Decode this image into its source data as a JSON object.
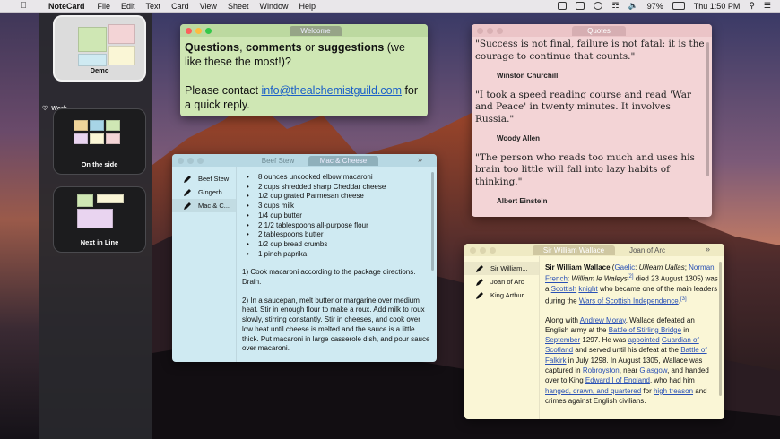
{
  "menubar": {
    "app": "NoteCard",
    "items": [
      "File",
      "Edit",
      "Text",
      "Card",
      "View",
      "Sheet",
      "Window",
      "Help"
    ],
    "battery": "97%",
    "clock": "Thu 1:50 PM"
  },
  "sidebar": {
    "boards": [
      {
        "label": "Demo"
      },
      {
        "label": "On the side"
      },
      {
        "label": "Next in Line"
      }
    ],
    "section": "Work"
  },
  "welcome": {
    "tab": "Welcome",
    "q_bold1": "Questions",
    "q_mid1": ", ",
    "q_bold2": "comments",
    "q_mid2": " or ",
    "q_bold3": "suggestions",
    "q_rest": " (we like these the most!)?",
    "contact_pre": "Please contact ",
    "email": "thealchemistguild.com",
    "email_prefix": "info@",
    "contact_post": " for a quick reply."
  },
  "quotes": {
    "tab": "Quotes",
    "items": [
      {
        "text": "\"Success is not final, failure is not fatal: it is the courage to continue that counts.\"",
        "author": "Winston Churchill"
      },
      {
        "text": "\"I took a speed reading course and read 'War and Peace' in twenty minutes. It involves Russia.\"",
        "author": "Woody Allen"
      },
      {
        "text": "\"The person who reads too much and uses his brain too little will fall into lazy habits of thinking.\"",
        "author": "Albert Einstein"
      }
    ]
  },
  "recipes": {
    "tabs": [
      "Beef Stew",
      "Mac & Cheese"
    ],
    "list": [
      "Beef Stew",
      "Gingerb...",
      "Mac & C..."
    ],
    "ingredients": [
      "8 ounces uncooked elbow macaroni",
      "2 cups shredded sharp Cheddar cheese",
      "1/2 cup grated Parmesan cheese",
      "3 cups milk",
      "1/4 cup butter",
      "2 1/2 tablespoons all-purpose flour",
      "2 tablespoons butter",
      "1/2 cup bread crumbs",
      "1 pinch paprika"
    ],
    "steps": [
      "1) Cook macaroni according to the package directions. Drain.",
      "2) In a saucepan, melt butter or margarine over medium heat. Stir in enough flour to make a roux. Add milk to roux slowly, stirring constantly. Stir in cheeses, and cook over low heat until cheese is melted and the sauce is a little thick. Put macaroni in large casserole dish, and pour sauce over macaroni."
    ]
  },
  "history": {
    "tabs": [
      "Sir William Wallace",
      "Joan of Arc"
    ],
    "list": [
      "Sir William...",
      "Joan of Arc",
      "King Arthur"
    ],
    "p1": {
      "name": "Sir William Wallace",
      "gaelic": "Gaelic",
      "gaelic_name": "Uilleam Uallas",
      "norman": "Norman French",
      "norman_pre": "William ",
      "norman_name": "le Waleys",
      "ref1": "[2]",
      "died": " died 23 August 1305) was a ",
      "scottish": "Scottish",
      "knight": "knight",
      "mid": " who became one of the main leaders during the ",
      "wars": "Wars of Scottish Independence",
      "ref2": "[3]"
    },
    "p2": {
      "along": "Along with ",
      "moray": "Andrew Moray",
      "defeated": ", Wallace defeated an English army at the ",
      "stirling": "Battle of Stirling Bridge",
      "in": " in ",
      "september": "September",
      "y1297": " 1297. He was ",
      "appointed": "appointed",
      "guardian": "Guardian of Scotland",
      "served": " and served until his defeat at the ",
      "falkirk": "Battle of Falkirk",
      "july": " in July 1298. In August 1305, Wallace was captured in ",
      "robroyston": "Robroyston",
      "near": ", near ",
      "glasgow": "Glasgow",
      "handed": ", and handed over to King ",
      "edward": "Edward I of England",
      "had": ", who had him ",
      "hanged": "hanged, drawn, and quartered",
      "for": " for ",
      "treason": "high treason",
      "end": " and crimes against English civilians."
    }
  },
  "colors": {
    "welcome": "#cfe7b4",
    "quotes": "#f3d4d6",
    "recipes": "#cfeaf2",
    "history": "#faf6d6",
    "link": "#2950b5"
  }
}
